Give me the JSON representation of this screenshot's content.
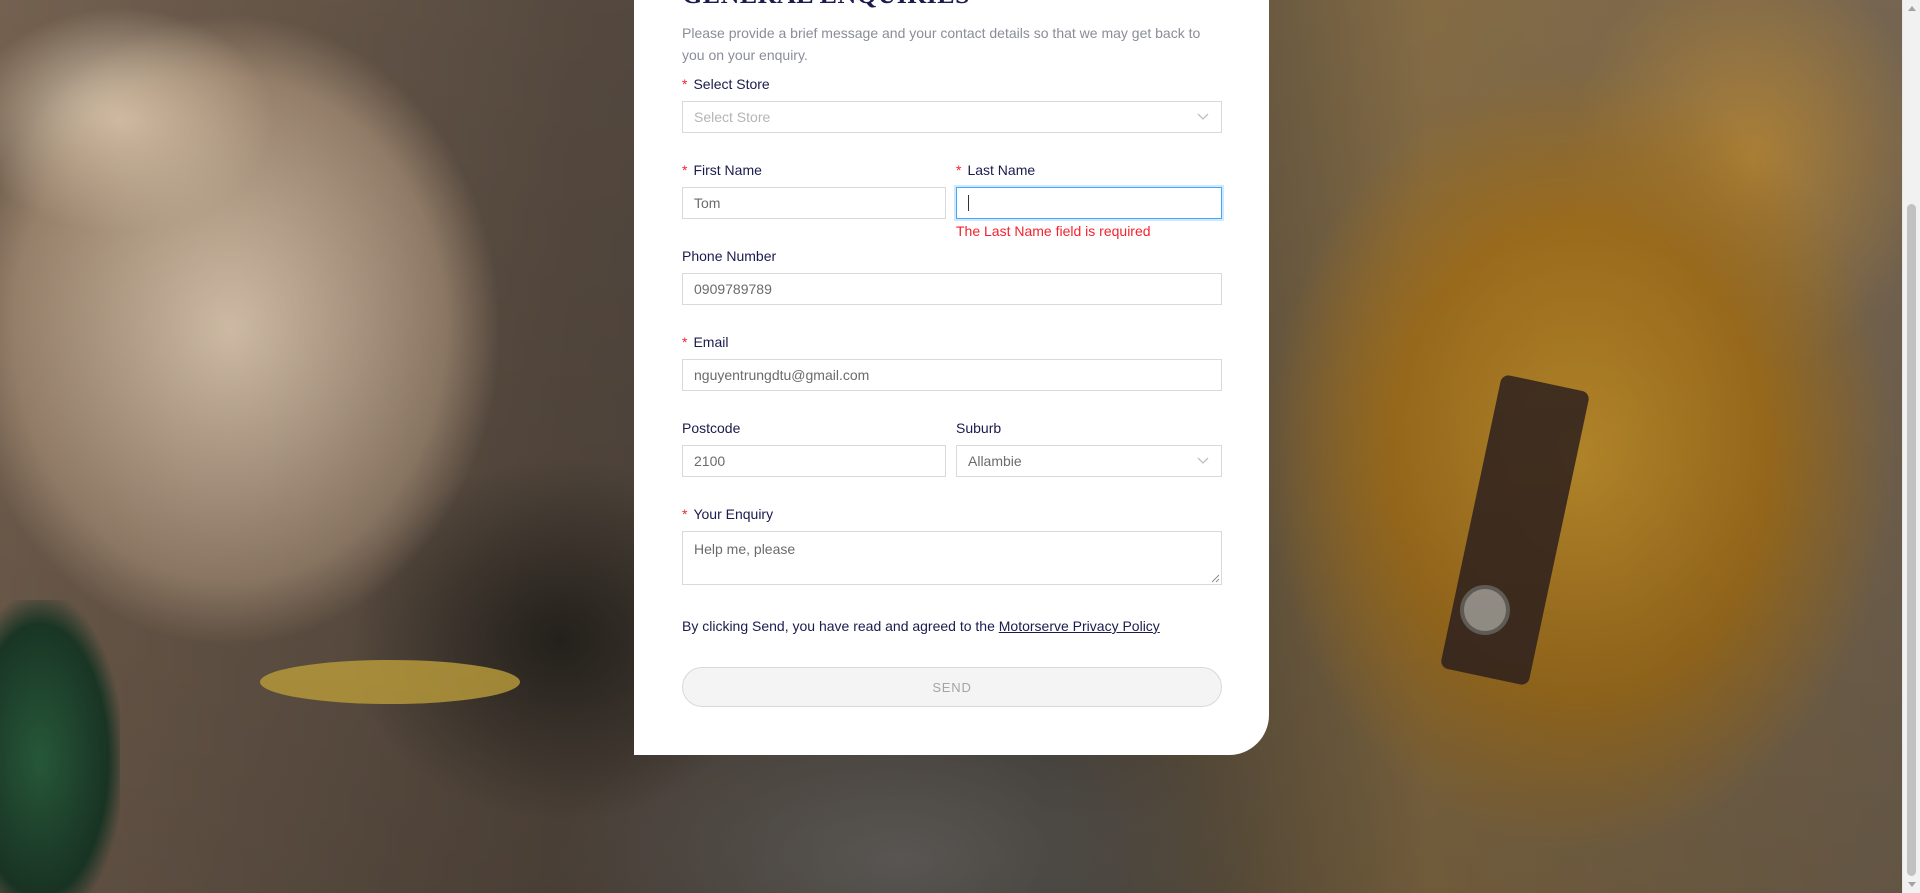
{
  "form": {
    "title": "GENERAL ENQUIRIES",
    "intro": "Please provide a brief message and your contact details so that we may get back to you on your enquiry.",
    "required_mark": "*",
    "store": {
      "label": "Select Store",
      "placeholder": "Select Store"
    },
    "first_name": {
      "label": "First Name",
      "value": "Tom"
    },
    "last_name": {
      "label": "Last Name",
      "value": "",
      "error": "The Last Name field is required"
    },
    "phone": {
      "label": "Phone Number",
      "value": "0909789789"
    },
    "email": {
      "label": "Email",
      "value": "nguyentrungdtu@gmail.com"
    },
    "postcode": {
      "label": "Postcode",
      "value": "2100"
    },
    "suburb": {
      "label": "Suburb",
      "value": "Allambie"
    },
    "enquiry": {
      "label": "Your Enquiry",
      "value": "Help me, please"
    },
    "policy_text": "By clicking Send, you have read and agreed to the ",
    "policy_link": "Motorserve Privacy Policy",
    "send_label": "SEND"
  },
  "icons": {
    "select_arrow": "chevron-down-icon",
    "scroll_up": "triangle-up-icon",
    "scroll_down": "triangle-down-icon"
  },
  "colors": {
    "heading": "#1b1b4d",
    "required": "#f5222d",
    "error": "#f5222d",
    "focus_border": "#40a9ff"
  }
}
